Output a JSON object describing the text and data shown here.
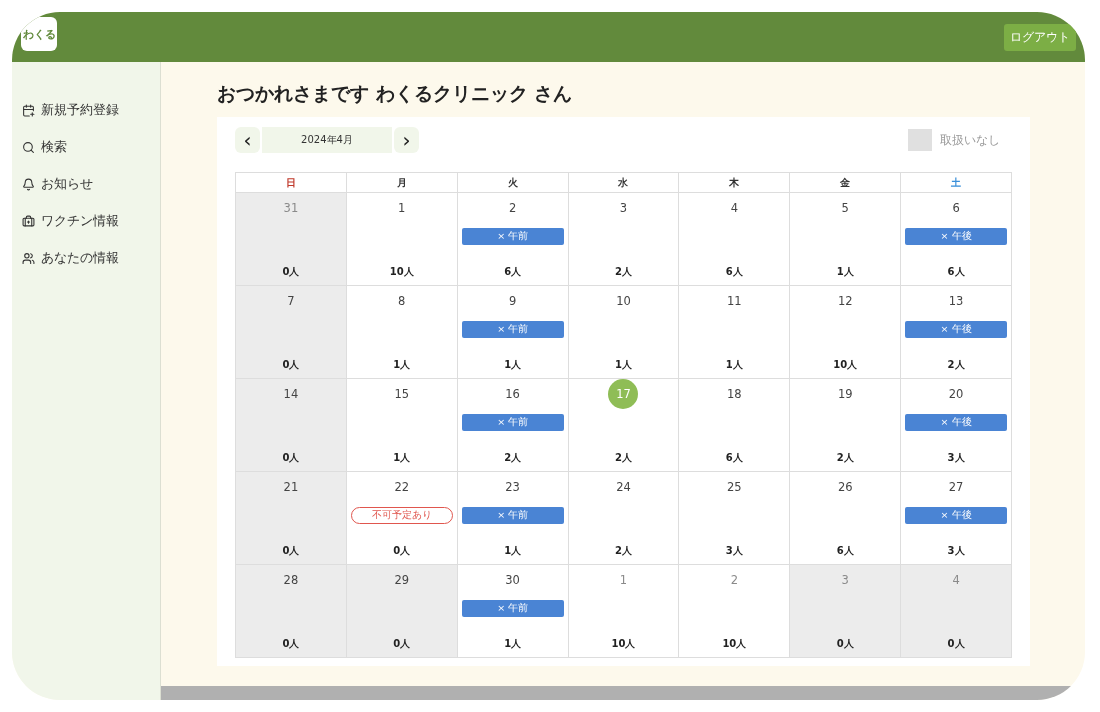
{
  "header": {
    "logo": "わくる",
    "logout": "ログアウト"
  },
  "sidebar": {
    "items": [
      {
        "label": "新規予約登録"
      },
      {
        "label": "検索"
      },
      {
        "label": "お知らせ"
      },
      {
        "label": "ワクチン情報"
      },
      {
        "label": "あなたの情報"
      }
    ]
  },
  "greeting": "おつかれさまです わくるクリニック さん",
  "calendar": {
    "prev": "‹",
    "month": "2024年4月",
    "next": "›",
    "legend": "取扱いなし",
    "weekdays": [
      {
        "label": "日",
        "kind": "sunday"
      },
      {
        "label": "月",
        "kind": "weekday"
      },
      {
        "label": "火",
        "kind": "weekday"
      },
      {
        "label": "水",
        "kind": "weekday"
      },
      {
        "label": "木",
        "kind": "weekday"
      },
      {
        "label": "金",
        "kind": "weekday"
      },
      {
        "label": "土",
        "kind": "saturday"
      }
    ],
    "weeks": [
      [
        {
          "day": "31",
          "count": "0人",
          "closed": true,
          "other_month": true,
          "today": false
        },
        {
          "day": "1",
          "count": "10人",
          "closed": false,
          "other_month": false,
          "today": false
        },
        {
          "day": "2",
          "count": "6人",
          "closed": false,
          "other_month": false,
          "today": false,
          "badge": {
            "kind": "slot",
            "label": "× 午前"
          }
        },
        {
          "day": "3",
          "count": "2人",
          "closed": false,
          "other_month": false,
          "today": false
        },
        {
          "day": "4",
          "count": "6人",
          "closed": false,
          "other_month": false,
          "today": false
        },
        {
          "day": "5",
          "count": "1人",
          "closed": false,
          "other_month": false,
          "today": false
        },
        {
          "day": "6",
          "count": "6人",
          "closed": false,
          "other_month": false,
          "today": false,
          "badge": {
            "kind": "slot",
            "label": "× 午後"
          }
        }
      ],
      [
        {
          "day": "7",
          "count": "0人",
          "closed": true,
          "other_month": false,
          "today": false
        },
        {
          "day": "8",
          "count": "1人",
          "closed": false,
          "other_month": false,
          "today": false
        },
        {
          "day": "9",
          "count": "1人",
          "closed": false,
          "other_month": false,
          "today": false,
          "badge": {
            "kind": "slot",
            "label": "× 午前"
          }
        },
        {
          "day": "10",
          "count": "1人",
          "closed": false,
          "other_month": false,
          "today": false
        },
        {
          "day": "11",
          "count": "1人",
          "closed": false,
          "other_month": false,
          "today": false
        },
        {
          "day": "12",
          "count": "10人",
          "closed": false,
          "other_month": false,
          "today": false
        },
        {
          "day": "13",
          "count": "2人",
          "closed": false,
          "other_month": false,
          "today": false,
          "badge": {
            "kind": "slot",
            "label": "× 午後"
          }
        }
      ],
      [
        {
          "day": "14",
          "count": "0人",
          "closed": true,
          "other_month": false,
          "today": false
        },
        {
          "day": "15",
          "count": "1人",
          "closed": false,
          "other_month": false,
          "today": false
        },
        {
          "day": "16",
          "count": "2人",
          "closed": false,
          "other_month": false,
          "today": false,
          "badge": {
            "kind": "slot",
            "label": "× 午前"
          }
        },
        {
          "day": "17",
          "count": "2人",
          "closed": false,
          "other_month": false,
          "today": true
        },
        {
          "day": "18",
          "count": "6人",
          "closed": false,
          "other_month": false,
          "today": false
        },
        {
          "day": "19",
          "count": "2人",
          "closed": false,
          "other_month": false,
          "today": false
        },
        {
          "day": "20",
          "count": "3人",
          "closed": false,
          "other_month": false,
          "today": false,
          "badge": {
            "kind": "slot",
            "label": "× 午後"
          }
        }
      ],
      [
        {
          "day": "21",
          "count": "0人",
          "closed": true,
          "other_month": false,
          "today": false
        },
        {
          "day": "22",
          "count": "0人",
          "closed": false,
          "other_month": false,
          "today": false,
          "badge": {
            "kind": "unavailable",
            "label": "不可予定あり"
          }
        },
        {
          "day": "23",
          "count": "1人",
          "closed": false,
          "other_month": false,
          "today": false,
          "badge": {
            "kind": "slot",
            "label": "× 午前"
          }
        },
        {
          "day": "24",
          "count": "2人",
          "closed": false,
          "other_month": false,
          "today": false
        },
        {
          "day": "25",
          "count": "3人",
          "closed": false,
          "other_month": false,
          "today": false
        },
        {
          "day": "26",
          "count": "6人",
          "closed": false,
          "other_month": false,
          "today": false
        },
        {
          "day": "27",
          "count": "3人",
          "closed": false,
          "other_month": false,
          "today": false,
          "badge": {
            "kind": "slot",
            "label": "× 午後"
          }
        }
      ],
      [
        {
          "day": "28",
          "count": "0人",
          "closed": true,
          "other_month": false,
          "today": false
        },
        {
          "day": "29",
          "count": "0人",
          "closed": true,
          "other_month": false,
          "today": false
        },
        {
          "day": "30",
          "count": "1人",
          "closed": false,
          "other_month": false,
          "today": false,
          "badge": {
            "kind": "slot",
            "label": "× 午前"
          }
        },
        {
          "day": "1",
          "count": "10人",
          "closed": false,
          "other_month": true,
          "today": false
        },
        {
          "day": "2",
          "count": "10人",
          "closed": false,
          "other_month": true,
          "today": false
        },
        {
          "day": "3",
          "count": "0人",
          "closed": true,
          "other_month": true,
          "today": false
        },
        {
          "day": "4",
          "count": "0人",
          "closed": true,
          "other_month": true,
          "today": false
        }
      ]
    ]
  }
}
